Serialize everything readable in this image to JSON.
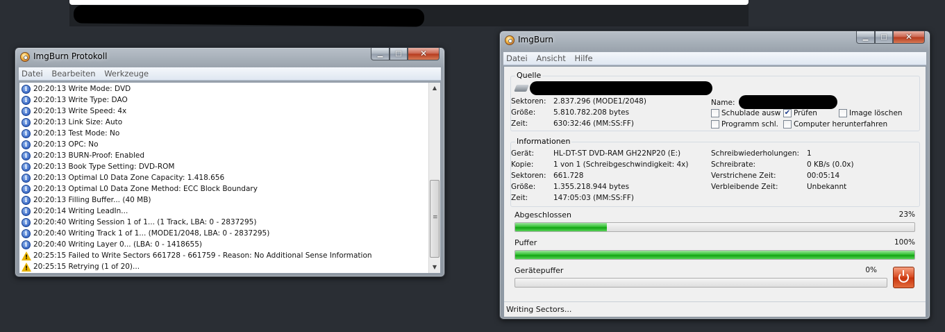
{
  "log_window": {
    "title": "ImgBurn Protokoll",
    "caption": {
      "minimize": "▁",
      "maximize": "□",
      "close": "✕"
    },
    "menu": [
      "Datei",
      "Bearbeiten",
      "Werkzeuge"
    ],
    "lines": [
      {
        "icon": "info",
        "text": "20:20:13 Write Mode: DVD"
      },
      {
        "icon": "info",
        "text": "20:20:13 Write Type: DAO"
      },
      {
        "icon": "info",
        "text": "20:20:13 Write Speed: 4x"
      },
      {
        "icon": "info",
        "text": "20:20:13 Link Size: Auto"
      },
      {
        "icon": "info",
        "text": "20:20:13 Test Mode: No"
      },
      {
        "icon": "info",
        "text": "20:20:13 OPC: No"
      },
      {
        "icon": "info",
        "text": "20:20:13 BURN-Proof: Enabled"
      },
      {
        "icon": "info",
        "text": "20:20:13 Book Type Setting: DVD-ROM"
      },
      {
        "icon": "info",
        "text": "20:20:13 Optimal L0 Data Zone Capacity: 1.418.656"
      },
      {
        "icon": "info",
        "text": "20:20:13 Optimal L0 Data Zone Method: ECC Block Boundary"
      },
      {
        "icon": "info",
        "text": "20:20:13 Filling Buffer... (40 MB)"
      },
      {
        "icon": "info",
        "text": "20:20:14 Writing LeadIn..."
      },
      {
        "icon": "info",
        "text": "20:20:40 Writing Session 1 of 1... (1 Track, LBA: 0 - 2837295)"
      },
      {
        "icon": "info",
        "text": "20:20:40 Writing Track 1 of 1... (MODE1/2048, LBA: 0 - 2837295)"
      },
      {
        "icon": "info",
        "text": "20:20:40 Writing Layer 0... (LBA: 0 - 1418655)"
      },
      {
        "icon": "warning",
        "text": "20:25:15 Failed to Write Sectors 661728 - 661759 - Reason: No Additional Sense Information"
      },
      {
        "icon": "warning",
        "text": "20:25:15 Retrying (1 of 20)..."
      }
    ]
  },
  "main_window": {
    "title": "ImgBurn",
    "caption": {
      "minimize": "▁",
      "maximize": "□",
      "close": "✕"
    },
    "menu": [
      "Datei",
      "Ansicht",
      "Hilfe"
    ],
    "source": {
      "title": "Quelle",
      "sectors_label": "Sektoren:",
      "sectors": "2.837.296 (MODE1/2048)",
      "size_label": "Größe:",
      "size": "5.810.782.208 bytes",
      "time_label": "Zeit:",
      "time": "630:32:46 (MM:SS:FF)",
      "name_label": "Name:",
      "options": [
        {
          "label": "Schublade ausw",
          "checked": false
        },
        {
          "label": "Prüfen",
          "checked": true
        },
        {
          "label": "Image löschen",
          "checked": false
        },
        {
          "label": "Programm schl.",
          "checked": false
        },
        {
          "label": "Computer herunterfahren",
          "checked": false
        }
      ]
    },
    "info": {
      "title": "Informationen",
      "device_label": "Gerät:",
      "device": "HL-DT-ST DVD-RAM GH22NP20 (E:)",
      "copy_label": "Kopie:",
      "copy": "1 von 1 (Schreibgeschwindigkeit: 4x)",
      "sectors_label": "Sektoren:",
      "sectors": "661.728",
      "size_label": "Größe:",
      "size": "1.355.218.944 bytes",
      "time_label": "Zeit:",
      "time": "147:05:03 (MM:SS:FF)",
      "retries_label": "Schreibwiederholungen:",
      "retries": "1",
      "rate_label": "Schreibrate:",
      "rate": "0 KB/s (0.0x)",
      "elapsed_label": "Verstrichene Zeit:",
      "elapsed": "00:05:14",
      "remaining_label": "Verbleibende Zeit:",
      "remaining": "Unbekannt"
    },
    "progress": {
      "completed_label": "Abgeschlossen",
      "completed_pct": "23%",
      "completed_value": 0.23,
      "buffer_label": "Puffer",
      "buffer_pct": "100%",
      "buffer_value": 1.0,
      "device_buffer_label": "Gerätepuffer",
      "device_buffer_pct": "0%",
      "device_buffer_value": 0.0
    },
    "status": "Writing Sectors..."
  }
}
